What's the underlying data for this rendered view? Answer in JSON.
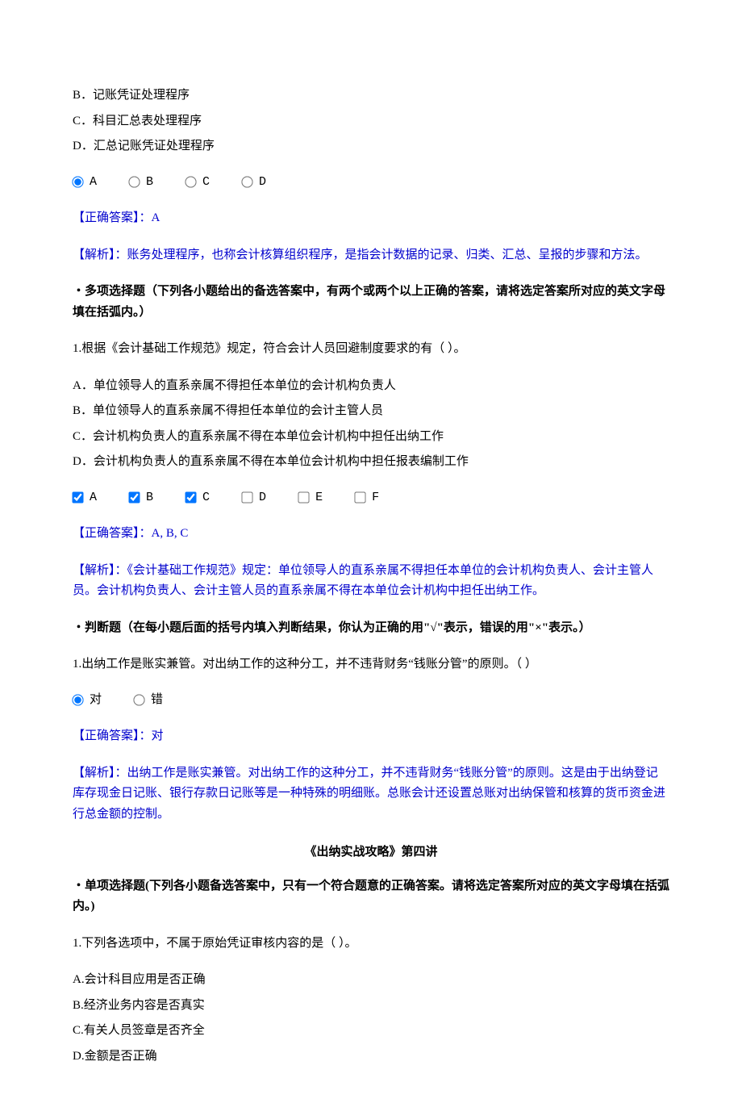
{
  "q_prev": {
    "opts": {
      "B": "B．记账凭证处理程序",
      "C": "C．科目汇总表处理程序",
      "D": "D．汇总记账凭证处理程序"
    },
    "radios": [
      "A",
      "B",
      "C",
      "D"
    ],
    "answer_label": "【正确答案】：",
    "answer_val": "A",
    "expl_label": "【解析】：",
    "expl": "账务处理程序，也称会计核算组织程序，是指会计数据的记录、归类、汇总、呈报的步骤和方法。"
  },
  "mcq": {
    "heading": "・多项选择题（下列各小题给出的备选答案中，有两个或两个以上正确的答案，请将选定答案所对应的英文字母填在括弧内。）",
    "q1": {
      "stem": "1.根据《会计基础工作规范》规定，符合会计人员回避制度要求的有（ ）。",
      "opts": {
        "A": "A．单位领导人的直系亲属不得担任本单位的会计机构负责人",
        "B": "B．单位领导人的直系亲属不得担任本单位的会计主管人员",
        "C": "C．会计机构负责人的直系亲属不得在本单位会计机构中担任出纳工作",
        "D": "D．会计机构负责人的直系亲属不得在本单位会计机构中担任报表编制工作"
      },
      "checks": [
        "A",
        "B",
        "C",
        "D",
        "E",
        "F"
      ],
      "answer_label": "【正确答案】：",
      "answer_val": "A, B, C",
      "expl_label": "【解析】：",
      "expl": "《会计基础工作规范》规定：单位领导人的直系亲属不得担任本单位的会计机构负责人、会计主管人员。会计机构负责人、会计主管人员的直系亲属不得在本单位会计机构中担任出纳工作。"
    }
  },
  "tf": {
    "heading": "・判断题（在每小题后面的括号内填入判断结果，你认为正确的用\"√\"表示，错误的用\"×\"表示。）",
    "q1": {
      "stem": "1.出纳工作是账实兼管。对出纳工作的这种分工，并不违背财务“钱账分管”的原则。（ ）",
      "true_label": "对",
      "false_label": "错",
      "answer_label": "【正确答案】：",
      "answer_val": "对",
      "expl_label": "【解析】：",
      "expl": "出纳工作是账实兼管。对出纳工作的这种分工，并不违背财务“钱账分管”的原则。这是由于出纳登记库存现金日记账、银行存款日记账等是一种特殊的明细账。总账会计还设置总账对出纳保管和核算的货币资金进行总金额的控制。"
    }
  },
  "ch4": {
    "title": "《出纳实战攻略》第四讲",
    "scq_heading": "・单项选择题(下列各小题备选答案中，只有一个符合题意的正确答案。请将选定答案所对应的英文字母填在括弧内。)",
    "q1": {
      "stem": "1.下列各选项中，不属于原始凭证审核内容的是（ ）。",
      "opts": {
        "A": "A.会计科目应用是否正确",
        "B": "B.经济业务内容是否真实",
        "C": "C.有关人员签章是否齐全",
        "D": "D.金额是否正确"
      }
    }
  }
}
